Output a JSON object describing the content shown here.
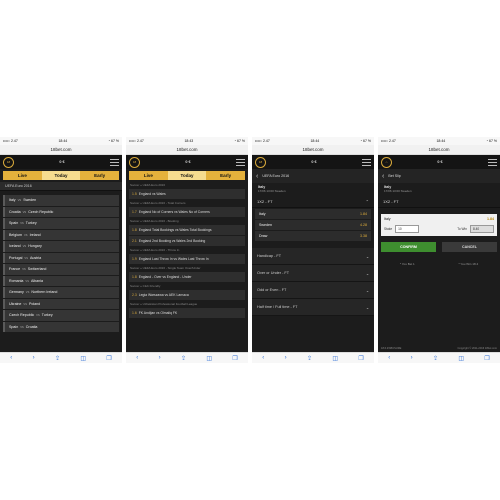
{
  "common": {
    "domain": "18bet.com",
    "balance": "0 €",
    "back_icon": "‹",
    "fwd_icon": "›",
    "share_icon": "⇪",
    "book_icon": "◫",
    "tabs_icon": "❐"
  },
  "panels": [
    {
      "status": {
        "carrier": "••••○ 2.47",
        "time": "18:44",
        "battery": "◔ 67 %"
      },
      "tabs": {
        "live": "Live",
        "today": "Today",
        "early": "Early"
      },
      "section": "UEFA Euro 2016",
      "matches": [
        {
          "home": "Italy",
          "vs": "vs",
          "away": "Sweden"
        },
        {
          "home": "Croatia",
          "vs": "vs",
          "away": "Czech Republic"
        },
        {
          "home": "Spain",
          "vs": "vs",
          "away": "Turkey"
        },
        {
          "home": "Belgium",
          "vs": "vs",
          "away": "Ireland"
        },
        {
          "home": "Iceland",
          "vs": "vs",
          "away": "Hungary"
        },
        {
          "home": "Portugal",
          "vs": "vs",
          "away": "Austria"
        },
        {
          "home": "France",
          "vs": "vs",
          "away": "Switzerland"
        },
        {
          "home": "Romania",
          "vs": "vs",
          "away": "Albania"
        },
        {
          "home": "Germany",
          "vs": "vs",
          "away": "Northern Ireland"
        },
        {
          "home": "Ukraine",
          "vs": "vs",
          "away": "Poland"
        },
        {
          "home": "Czech Republic",
          "vs": "vs",
          "away": "Turkey"
        },
        {
          "home": "Spain",
          "vs": "vs",
          "away": "Croatia"
        }
      ]
    },
    {
      "status": {
        "carrier": "••••○ 2.47",
        "time": "18:43",
        "battery": "◔ 67 %"
      },
      "tabs": {
        "live": "Live",
        "today": "Today",
        "early": "Early"
      },
      "markets": [
        {
          "sub": "Soccer » UEFA Euro 2016",
          "odd": "1.5",
          "label": "England vs Wales"
        },
        {
          "sub": "Soccer » UEFA Euro 2016 - Total Corners",
          "odd": "1.7",
          "label": "England No of Corners vs Wales No of Corners"
        },
        {
          "sub": "Soccer » UEFA Euro 2016 - Booking",
          "odd": "1.8",
          "label": "England Total Bookings vs Wales Total Bookings"
        },
        {
          "sub": "",
          "odd": "2.1",
          "label": "England 2nd Booking vs Wales 2nd Booking"
        },
        {
          "sub": "Soccer » UEFA Euro 2016 - Throw In",
          "odd": "1.9",
          "label": "England Last Throw In vs Wales Last Throw In"
        },
        {
          "sub": "Soccer » UEFA Euro 2016 - Single Team Over/Under",
          "odd": "1.8",
          "label": "England - Over vs England - Under"
        },
        {
          "sub": "Soccer » Club Friendly",
          "odd": "2.3",
          "label": "Legia Warszawa vs AEK Larnaca"
        },
        {
          "sub": "Soccer » Uzbekistan Professional Football League",
          "odd": "1.6",
          "label": "FK Andijan vs Olmaliq FK"
        }
      ]
    },
    {
      "status": {
        "carrier": "••••○ 2.47",
        "time": "18:44",
        "battery": "◔ 67 %"
      },
      "header": "UEFA Euro 2016",
      "event": {
        "title": "Italy",
        "sub": "17/06 13:00 Sweden"
      },
      "market_title": "1X2 - FT",
      "rows": [
        {
          "label": "Italy",
          "price": "1.84"
        },
        {
          "label": "Sweden",
          "price": "4.28"
        },
        {
          "label": "Draw",
          "price": "3.38"
        }
      ],
      "collapsed": [
        "Handicap - FT",
        "Over or Under - FT",
        "Odd or Even - FT",
        "Half time / Full time - FT"
      ]
    },
    {
      "status": {
        "carrier": "••••○ 2.47",
        "time": "18:44",
        "battery": "◔ 67 %"
      },
      "header": "Bet Slip",
      "event": {
        "title": "Italy",
        "sub": "17/06 13:00 Sweden"
      },
      "market_title": "1X2 - FT",
      "pick": {
        "label": "Italy",
        "price": "1.84"
      },
      "stake_label": "Stake",
      "stake_value": "10",
      "towin_label": "To Win",
      "towin_value": "8.40",
      "confirm": "CONFIRM",
      "cancel": "CANCEL",
      "note1": "* You Bet 1",
      "note2": "* You Win 18.4",
      "footer_left": "18.6.2%BCSURE",
      "footer_right": "Copyright © 2011-2016 18bet.com"
    }
  ]
}
